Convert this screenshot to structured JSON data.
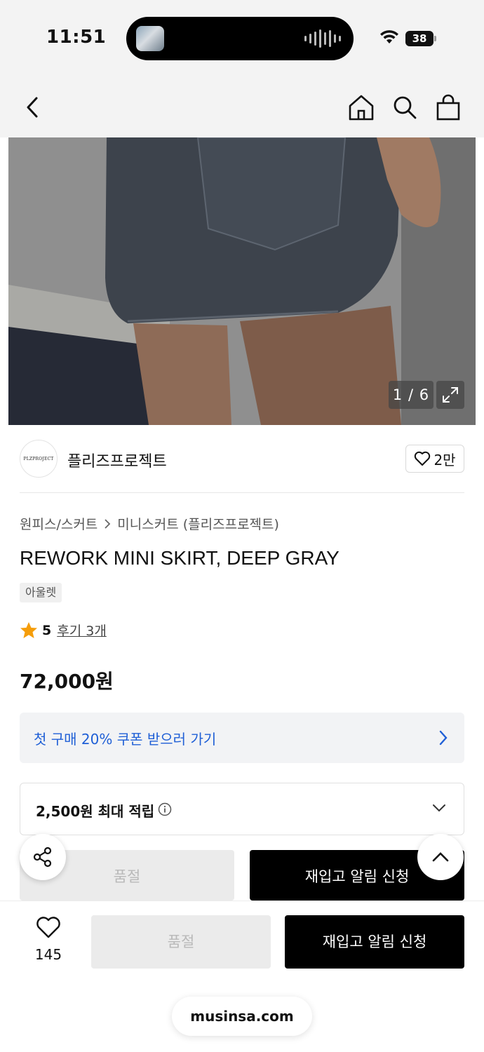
{
  "status_bar": {
    "time": "11:51",
    "battery": "38"
  },
  "gallery": {
    "counter": "1 / 6"
  },
  "brand": {
    "logo_text": "PLZPROJECT",
    "name": "플리즈프로젝트",
    "likes": "2만"
  },
  "product": {
    "breadcrumb": [
      "원피스/스커트",
      "미니스커트 (플리즈프로젝트)"
    ],
    "title": "REWORK MINI SKIRT, DEEP GRAY",
    "tag": "아울렛",
    "rating": "5",
    "reviews": "후기 3개",
    "price": "72,000원"
  },
  "coupon": {
    "label": "첫 구매 20% 쿠폰 받으러 가기"
  },
  "points": {
    "label": "2,500원 최대 적립"
  },
  "inline_actions": {
    "sold_out": "품절",
    "restock": "재입고 알림 신청"
  },
  "bottom_bar": {
    "like_count": "145",
    "sold_out": "품절",
    "restock": "재입고 알림 신청"
  },
  "browser": {
    "url": "musinsa.com"
  },
  "colors": {
    "accent_blue": "#1f5fd6",
    "star": "#f59d0a",
    "primary_button": "#000000",
    "disabled_button": "#ebebeb"
  },
  "icons": [
    "back-icon",
    "home-icon",
    "search-icon",
    "cart-icon",
    "expand-icon",
    "heart-icon",
    "star-icon",
    "chevron-right-icon",
    "info-icon",
    "chevron-down-icon",
    "share-icon",
    "chevron-up-icon"
  ]
}
